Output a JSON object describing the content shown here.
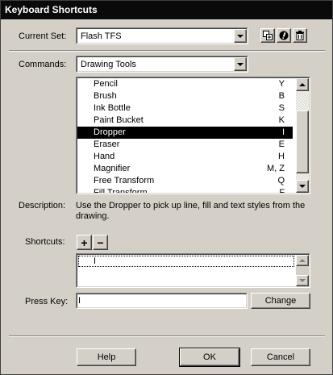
{
  "window": {
    "title": "Keyboard Shortcuts"
  },
  "current_set": {
    "label": "Current Set:",
    "value": "Flash TFS"
  },
  "commands": {
    "label": "Commands:",
    "value": "Drawing Tools"
  },
  "toolbar": {
    "icons": [
      "duplicate-set-icon",
      "rename-set-icon",
      "delete-set-icon"
    ]
  },
  "command_list": {
    "items": [
      {
        "name": "Pencil",
        "key": "Y"
      },
      {
        "name": "Brush",
        "key": "B"
      },
      {
        "name": "Ink Bottle",
        "key": "S"
      },
      {
        "name": "Paint Bucket",
        "key": "K"
      },
      {
        "name": "Dropper",
        "key": "I",
        "selected": true
      },
      {
        "name": "Eraser",
        "key": "E"
      },
      {
        "name": "Hand",
        "key": "H"
      },
      {
        "name": "Magnifier",
        "key": "M, Z"
      },
      {
        "name": "Free Transform",
        "key": "Q"
      },
      {
        "name": "Fill Transform",
        "key": "F"
      }
    ]
  },
  "description": {
    "label": "Description:",
    "text": "Use the Dropper to pick up line, fill and text styles from the drawing."
  },
  "shortcuts": {
    "label": "Shortcuts:",
    "add_label": "+",
    "remove_label": "−",
    "items": [
      "I"
    ]
  },
  "press_key": {
    "label": "Press Key:",
    "value": "I",
    "change_label": "Change"
  },
  "footer": {
    "help_label": "Help",
    "ok_label": "OK",
    "cancel_label": "Cancel"
  }
}
